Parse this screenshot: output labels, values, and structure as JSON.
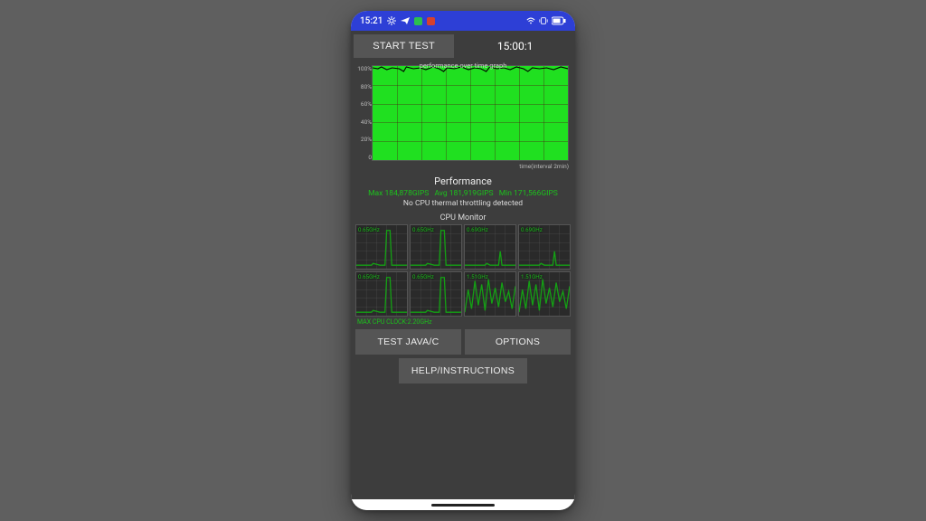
{
  "statusbar": {
    "time": "15:21",
    "icons_left": [
      "gear-icon",
      "telegram-icon",
      "app-icon-green",
      "app-icon-red"
    ],
    "icons_right": [
      "wifi-icon",
      "vibrate-icon",
      "battery-icon"
    ]
  },
  "topbar": {
    "start_label": "START TEST",
    "timer": "15:00:1"
  },
  "graph": {
    "title": "performance over time graph",
    "y_ticks": [
      "100%",
      "80%",
      "60%",
      "40%",
      "20%",
      "0"
    ],
    "footer": "time(interval 2min)"
  },
  "performance": {
    "heading": "Performance",
    "max": "Max 184,878GIPS",
    "avg": "Avg 181,919GIPS",
    "min": "Min 171,566GIPS",
    "note": "No CPU thermal throttling detected"
  },
  "cpu": {
    "heading": "CPU Monitor",
    "cells": [
      {
        "label": "0.65GHz",
        "pattern": "spike"
      },
      {
        "label": "0.65GHz",
        "pattern": "spike"
      },
      {
        "label": "0.69GHz",
        "pattern": "spike_small"
      },
      {
        "label": "0.69GHz",
        "pattern": "spike_small"
      },
      {
        "label": "0.65GHz",
        "pattern": "spike"
      },
      {
        "label": "0.65GHz",
        "pattern": "spike"
      },
      {
        "label": "1.51GHz",
        "pattern": "noisy"
      },
      {
        "label": "1.51GHz",
        "pattern": "noisy"
      }
    ],
    "max_clock": "MAX CPU CLOCK:2.20GHz"
  },
  "buttons": {
    "test_java": "TEST JAVA/C",
    "options": "OPTIONS",
    "help": "HELP/INSTRUCTIONS"
  },
  "chart_data": {
    "type": "area",
    "title": "performance over time graph",
    "xlabel": "time(interval 2min)",
    "ylabel": "%",
    "ylim": [
      0,
      100
    ],
    "x": [
      0,
      1,
      2,
      3,
      4,
      5,
      6,
      7
    ],
    "values": [
      98,
      99,
      97,
      99,
      98,
      99,
      98,
      99
    ]
  }
}
